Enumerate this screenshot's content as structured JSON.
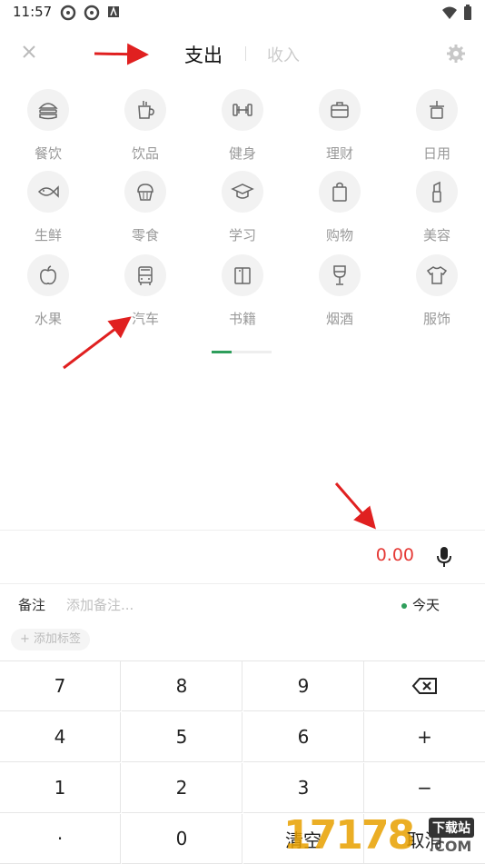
{
  "status_bar": {
    "time": "11:57"
  },
  "header": {
    "tab_expense": "支出",
    "tab_income": "收入"
  },
  "categories": [
    {
      "label": "餐饮",
      "icon": "burger-icon"
    },
    {
      "label": "饮品",
      "icon": "cup-icon"
    },
    {
      "label": "健身",
      "icon": "dumbbell-icon"
    },
    {
      "label": "理财",
      "icon": "briefcase-icon"
    },
    {
      "label": "日用",
      "icon": "daily-icon"
    },
    {
      "label": "生鲜",
      "icon": "fish-icon"
    },
    {
      "label": "零食",
      "icon": "muffin-icon"
    },
    {
      "label": "学习",
      "icon": "graduation-cap-icon"
    },
    {
      "label": "购物",
      "icon": "shopping-bag-icon"
    },
    {
      "label": "美容",
      "icon": "lipstick-icon"
    },
    {
      "label": "水果",
      "icon": "apple-icon"
    },
    {
      "label": "汽车",
      "icon": "bus-icon"
    },
    {
      "label": "书籍",
      "icon": "book-icon"
    },
    {
      "label": "烟酒",
      "icon": "wine-glass-icon"
    },
    {
      "label": "服饰",
      "icon": "tshirt-icon"
    }
  ],
  "pager": {
    "page": 1,
    "pages": 3
  },
  "amount": "0.00",
  "note": {
    "label": "备注",
    "placeholder": "添加备注...",
    "date": "今天"
  },
  "tag_button": "+ 添加标签",
  "keypad": {
    "k7": "7",
    "k8": "8",
    "k9": "9",
    "k4": "4",
    "k5": "5",
    "k6": "6",
    "plus": "+",
    "k1": "1",
    "k2": "2",
    "k3": "3",
    "minus": "−",
    "dot": "·",
    "k0": "0",
    "clear": "清空",
    "cancel": "取消"
  },
  "watermark": {
    "text": "17178",
    "badge": "下载站",
    "domain": ".COM"
  },
  "colors": {
    "accent": "#2e9e5b",
    "amount": "#e53935",
    "arrow": "#e02020"
  }
}
